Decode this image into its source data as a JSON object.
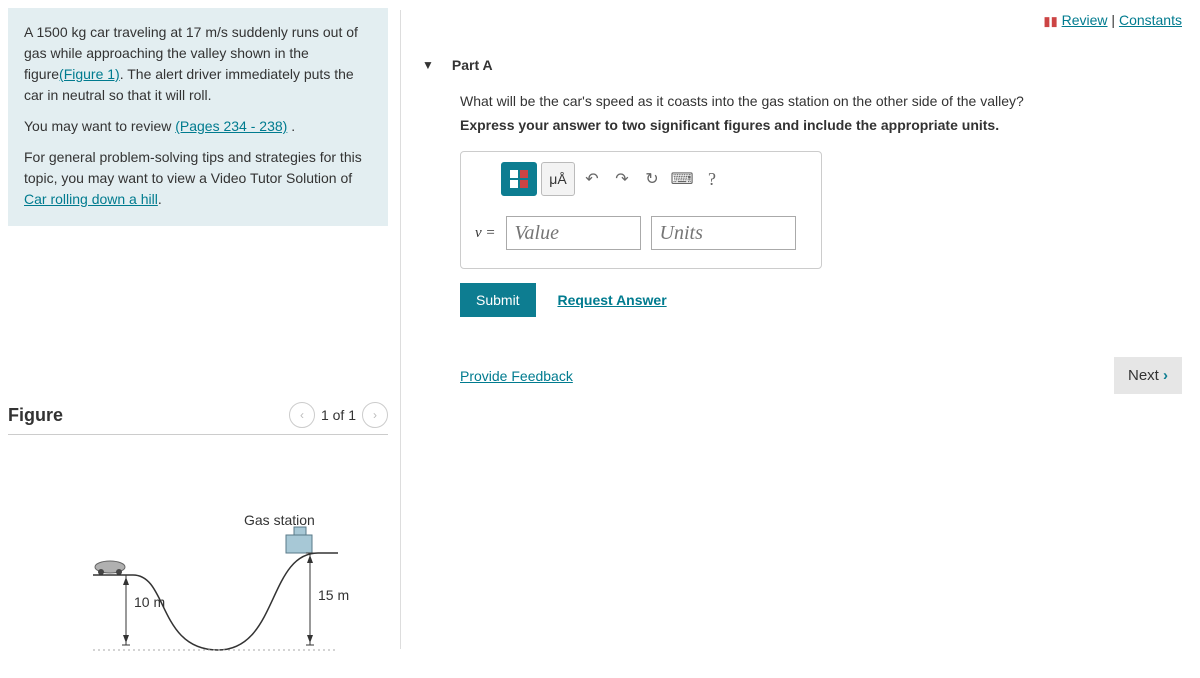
{
  "topbar": {
    "review": "Review",
    "constants": "Constants"
  },
  "problem": {
    "p1_a": "A 1500 ",
    "p1_b": "kg",
    "p1_c": " car traveling at 17 ",
    "p1_d": "m/s",
    "p1_e": " suddenly runs out of gas while approaching the valley shown in the figure",
    "fig_link": "(Figure 1)",
    "p1_f": ". The alert driver immediately puts the car in neutral so that it will roll.",
    "p2_a": "You may want to review ",
    "pages_link": "(Pages 234 - 238)",
    "p2_b": " .",
    "p3_a": "For general problem-solving tips and strategies for this topic, you may want to view a Video Tutor Solution of ",
    "car_link": "Car rolling down a hill",
    "p3_b": "."
  },
  "figure": {
    "title": "Figure",
    "counter": "1 of 1",
    "gas_label": "Gas station",
    "h1": "10 m",
    "h2": "15 m"
  },
  "part": {
    "label": "Part A",
    "q": "What will be the car's speed as it coasts into the gas station on the other side of the valley?",
    "instr": "Express your answer to two significant figures and include the appropriate units.",
    "vprefix": "v = ",
    "value_ph": "Value",
    "units_ph": "Units",
    "mu": "μÅ",
    "submit": "Submit",
    "request": "Request Answer"
  },
  "footer": {
    "feedback": "Provide Feedback",
    "next": "Next "
  }
}
